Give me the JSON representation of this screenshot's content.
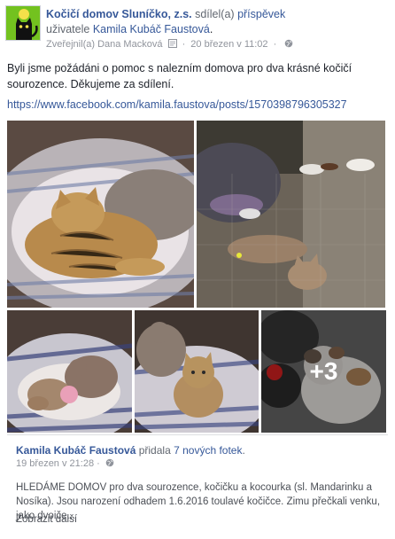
{
  "header": {
    "page_name": "Kočičí domov Sluníčko, z.s.",
    "shared_text": "sdílel(a)",
    "post_link": "příspěvek",
    "user_prefix": "uživatele",
    "author_name": "Kamila Kubáč Faustová",
    "author_suffix": ".",
    "meta_shared_by": "Zveřejnil(a) Dana Macková",
    "meta_separator": "·",
    "meta_date": "20 březen v 11:02",
    "meta_dot": "·"
  },
  "post": {
    "text": "Byli jsme požádáni o pomoc s nalezním domova pro dva krásné kočičí sourozence. Děkujeme za sdílení.",
    "url": "https://www.facebook.com/kamila.faustova/posts/1570398796305327"
  },
  "photos": {
    "more_count": "+3"
  },
  "shared_post": {
    "author": "Kamila Kubáč Faustová",
    "added_text": "přidala",
    "photos_link": "7 nových fotek",
    "after_link": ".",
    "date": "19 březen v 21:28",
    "meta_dot": "·",
    "text": "HLEDÁME DOMOV pro dva sourozence, kočičku a kocourka (sl. Mandarinku a Nosíka). Jsou narození odhadem 1.6.2016 toulavé kočičce. Zimu přečkali venku, jako dvoiče...",
    "see_more": "Zobrazit další"
  },
  "colors": {
    "link": "#365899",
    "text": "#1d2129",
    "meta": "#90949c",
    "avatar_bg": "#6fbf1f"
  },
  "icons": [
    "page-logo-cat-icon",
    "globe-icon",
    "group-icon"
  ]
}
